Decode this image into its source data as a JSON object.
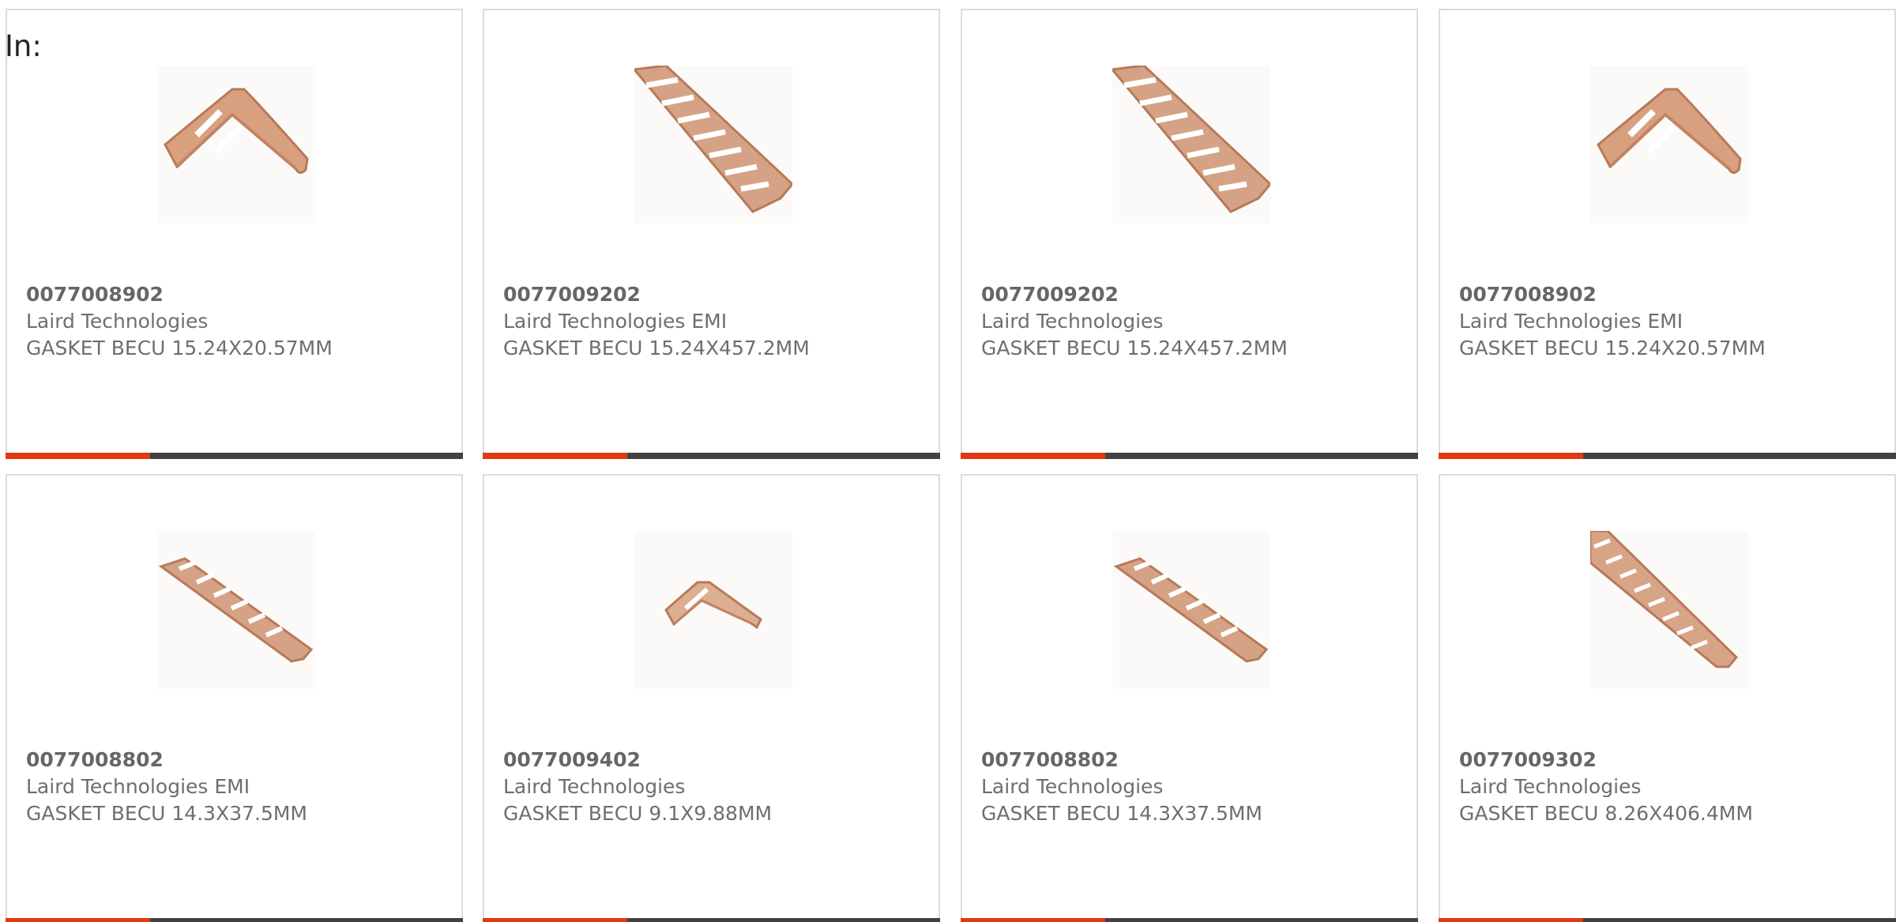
{
  "page": {
    "in_label": "In:"
  },
  "colors": {
    "accent": "#e03a12",
    "bar": "#424242",
    "copper": "#d9a07f"
  },
  "products": [
    {
      "part_number": "0077008902",
      "brand": "Laird Technologies",
      "description": "GASKET BECU 15.24X20.57MM",
      "image": "gasket-short-wide"
    },
    {
      "part_number": "0077009202",
      "brand": "Laird Technologies EMI",
      "description": "GASKET BECU 15.24X457.2MM",
      "image": "gasket-long-strip"
    },
    {
      "part_number": "0077009202",
      "brand": "Laird Technologies",
      "description": "GASKET BECU 15.24X457.2MM",
      "image": "gasket-long-strip"
    },
    {
      "part_number": "0077008902",
      "brand": "Laird Technologies EMI",
      "description": "GASKET BECU 15.24X20.57MM",
      "image": "gasket-short-wide"
    },
    {
      "part_number": "0077008802",
      "brand": "Laird Technologies EMI",
      "description": "GASKET BECU 14.3X37.5MM",
      "image": "gasket-thin-strip"
    },
    {
      "part_number": "0077009402",
      "brand": "Laird Technologies",
      "description": "GASKET BECU 9.1X9.88MM",
      "image": "gasket-small-clip"
    },
    {
      "part_number": "0077008802",
      "brand": "Laird Technologies",
      "description": "GASKET BECU 14.3X37.5MM",
      "image": "gasket-thin-strip"
    },
    {
      "part_number": "0077009302",
      "brand": "Laird Technologies",
      "description": "GASKET BECU 8.26X406.4MM",
      "image": "gasket-long-strip"
    }
  ]
}
